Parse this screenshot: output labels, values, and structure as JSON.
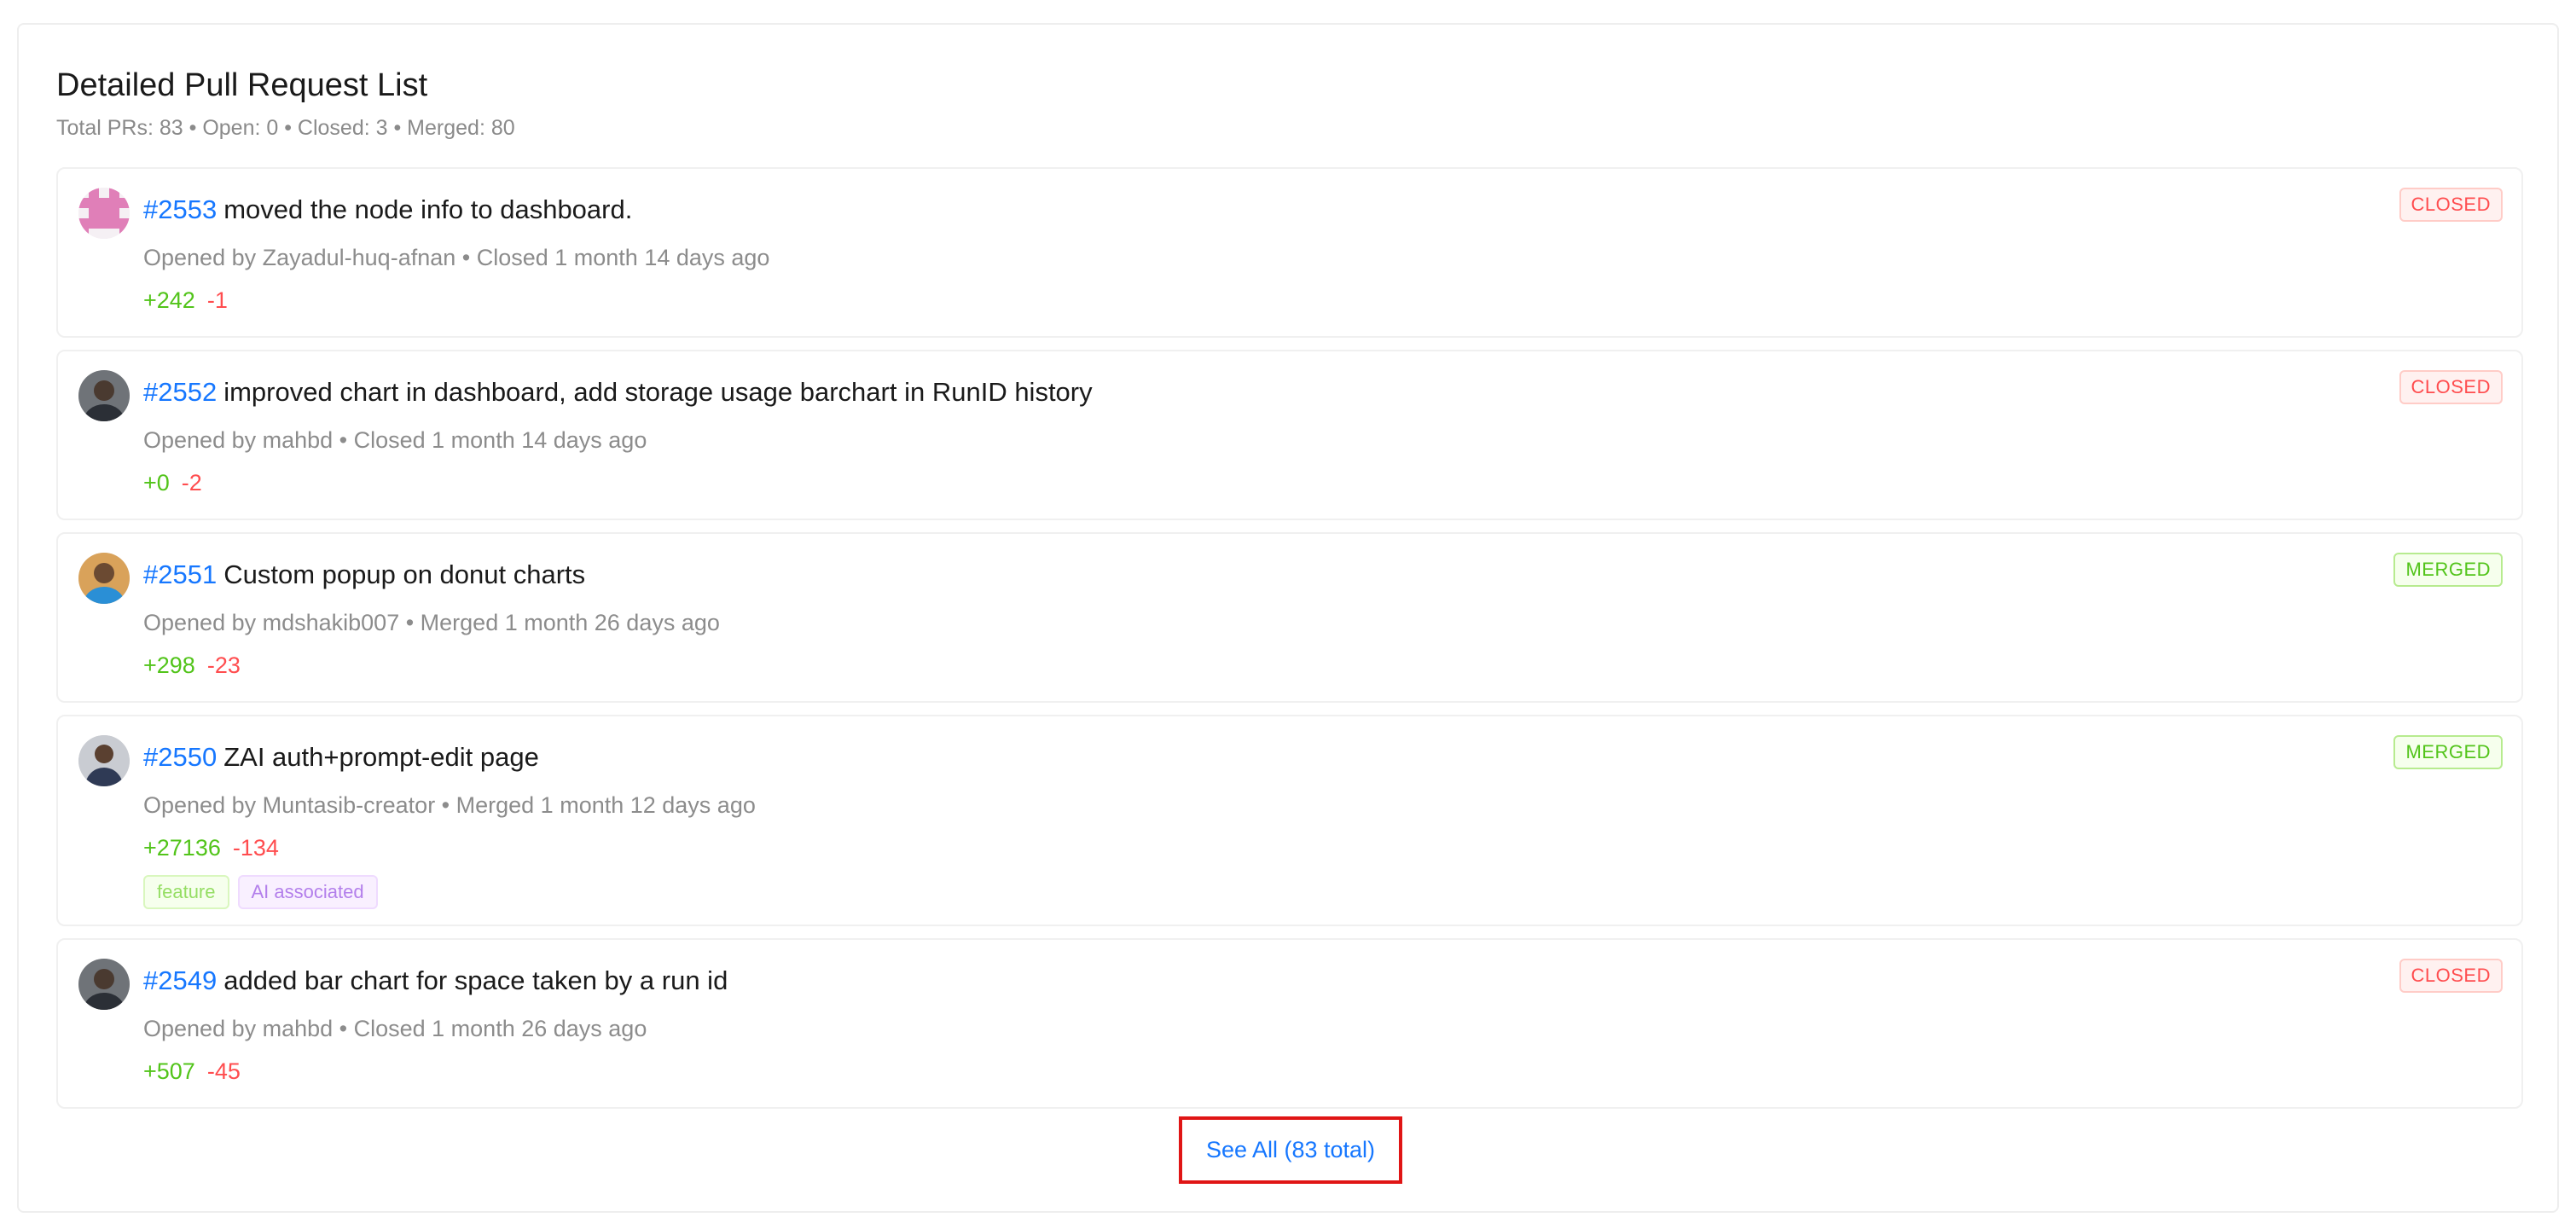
{
  "header": {
    "title": "Detailed Pull Request List",
    "summary": "Total PRs: 83 • Open: 0 • Closed: 3 • Merged: 80"
  },
  "pull_requests": [
    {
      "number": "#2553",
      "title": "moved the node info to dashboard.",
      "meta": "Opened by Zayadul-huq-afnan • Closed 1 month 14 days ago",
      "additions": "+242",
      "deletions": "-1",
      "status": "CLOSED",
      "avatar": "identicon-pink"
    },
    {
      "number": "#2552",
      "title": "improved chart in dashboard, add storage usage barchart in RunID history",
      "meta": "Opened by mahbd • Closed 1 month 14 days ago",
      "additions": "+0",
      "deletions": "-2",
      "status": "CLOSED",
      "avatar": "photo-person"
    },
    {
      "number": "#2551",
      "title": "Custom popup on donut charts",
      "meta": "Opened by mdshakib007 • Merged 1 month 26 days ago",
      "additions": "+298",
      "deletions": "-23",
      "status": "MERGED",
      "avatar": "photo-person-blue"
    },
    {
      "number": "#2550",
      "title": "ZAI auth+prompt-edit page",
      "meta": "Opened by Muntasib-creator • Merged 1 month 12 days ago",
      "additions": "+27136",
      "deletions": "-134",
      "status": "MERGED",
      "avatar": "photo-person-suit",
      "tags": [
        "feature",
        "AI associated"
      ]
    },
    {
      "number": "#2549",
      "title": "added bar chart for space taken by a run id",
      "meta": "Opened by mahbd • Closed 1 month 26 days ago",
      "additions": "+507",
      "deletions": "-45",
      "status": "CLOSED",
      "avatar": "photo-person"
    }
  ],
  "footer": {
    "see_all_label": "See All (83 total)"
  },
  "colors": {
    "link": "#1677ff",
    "addition": "#52c41a",
    "deletion": "#ff4d4f",
    "highlight_border": "#e01515"
  }
}
